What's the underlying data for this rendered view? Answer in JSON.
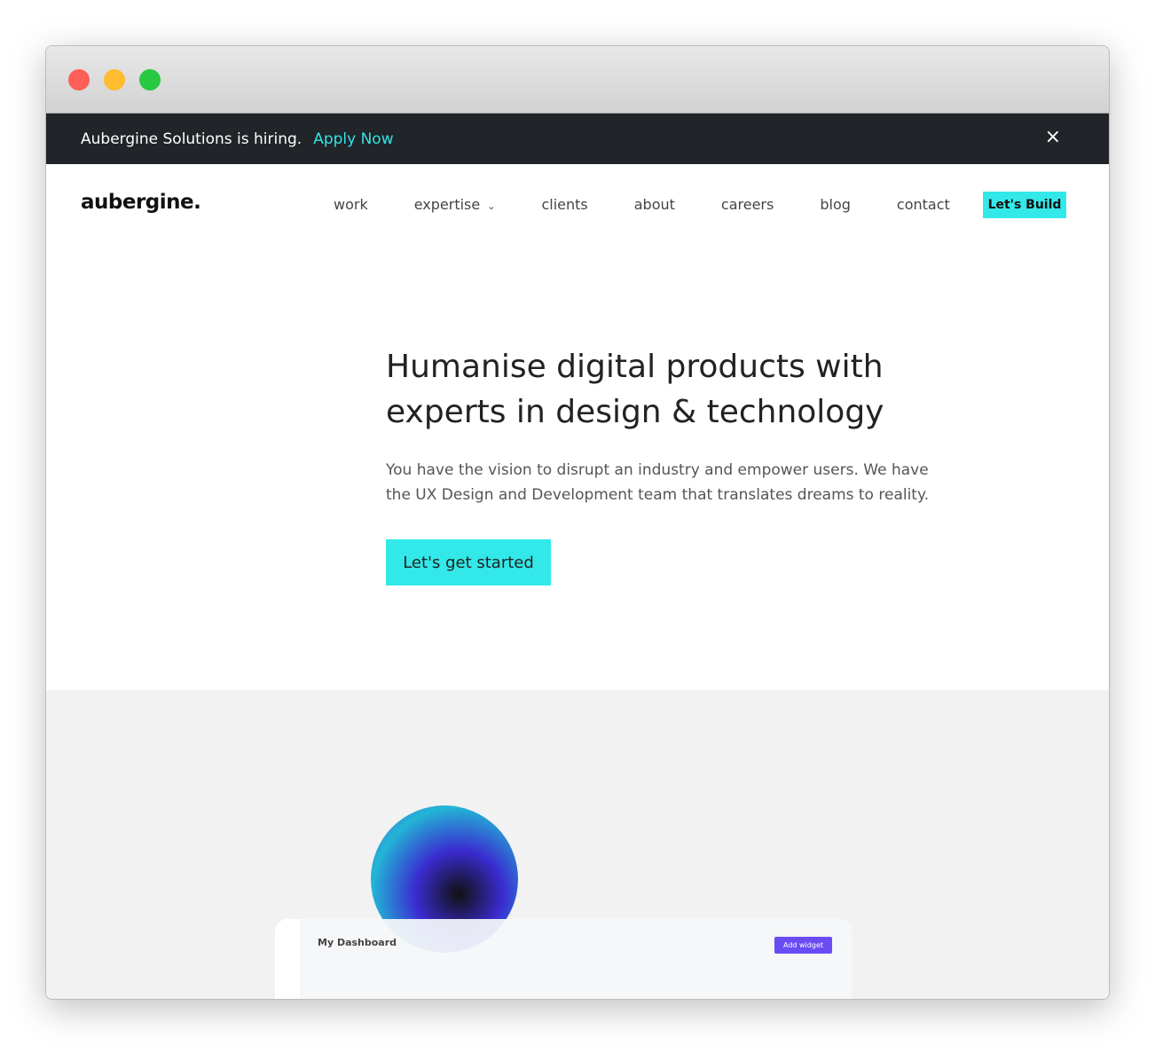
{
  "banner": {
    "text": "Aubergine Solutions is hiring.",
    "link": "Apply Now",
    "close": "×"
  },
  "nav": {
    "logo": "aubergine.",
    "links": [
      "work",
      "expertise",
      "clients",
      "about",
      "careers",
      "blog",
      "contact"
    ],
    "cta": "Let's Build"
  },
  "hero": {
    "title": "Humanise digital products with experts in design & technology",
    "subtitle": "You have the vision to disrupt an industry and empower users. We have the UX Design and Development team that translates dreams to reality.",
    "button": "Let's get started"
  },
  "dashboard": {
    "title": "My Dashboard",
    "button": "Add widget"
  },
  "colors": {
    "accent": "#33e8e8",
    "banner_bg": "#212428",
    "purple": "#6a4cf5"
  }
}
